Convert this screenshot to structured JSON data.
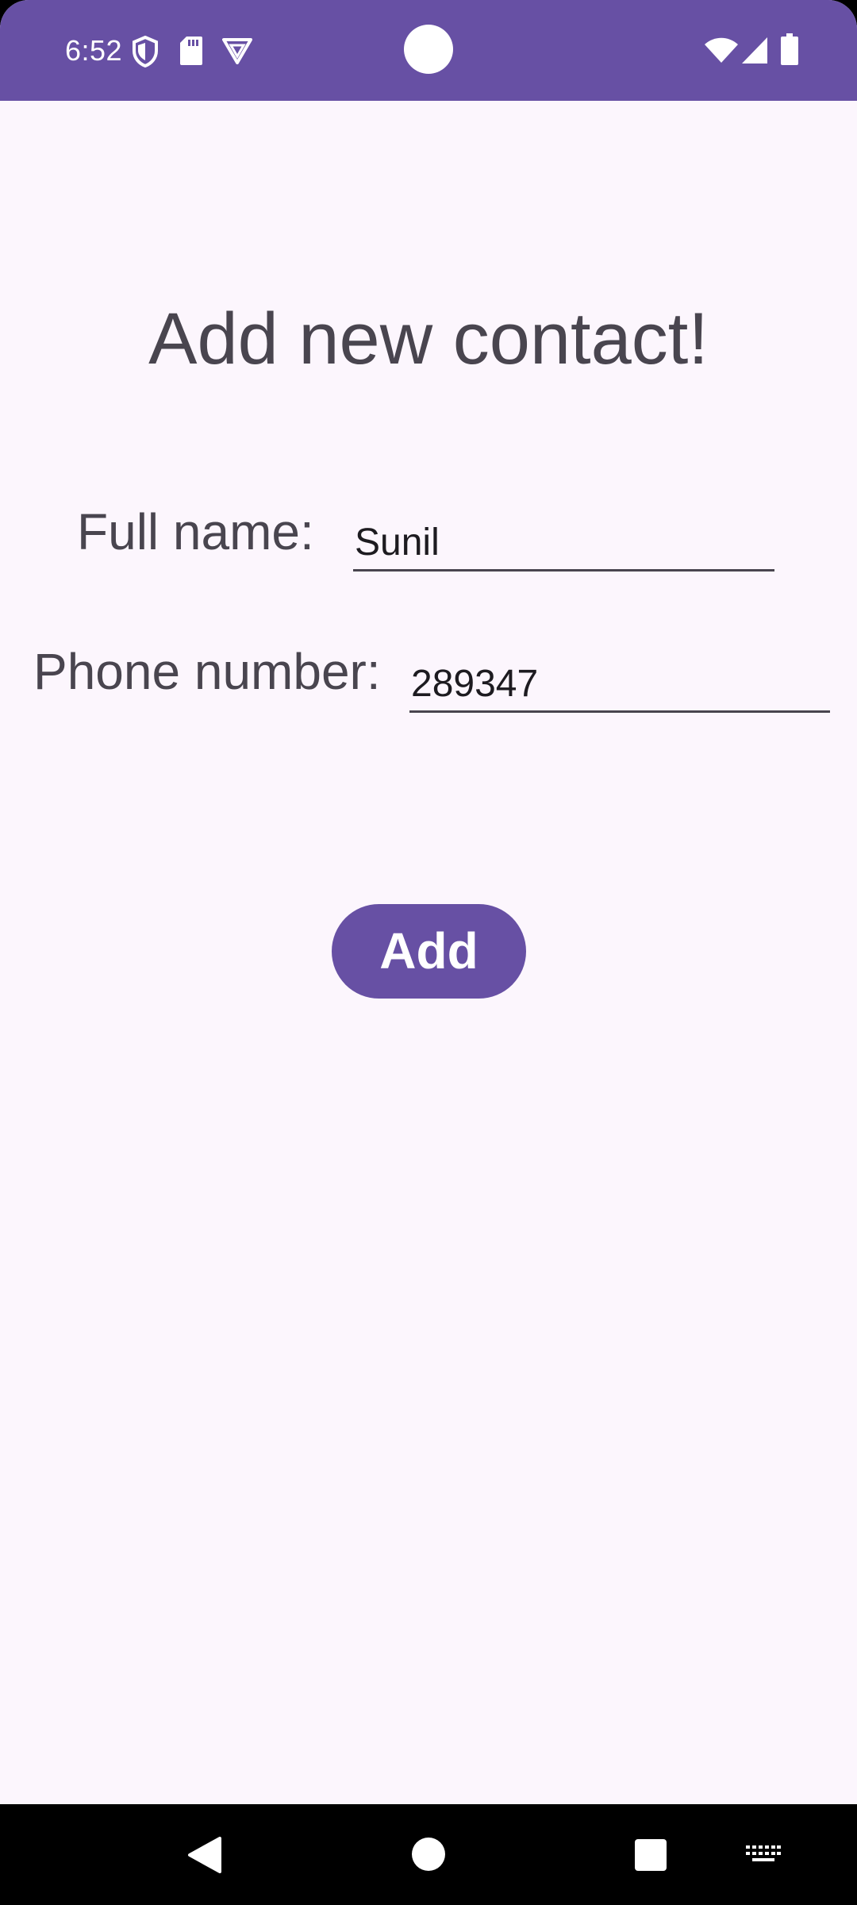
{
  "status_bar": {
    "time": "6:52",
    "color": "#6750a4",
    "left_icons": [
      "shield-icon",
      "sd-card-icon",
      "vpn-icon"
    ],
    "right_icons": [
      "wifi-icon",
      "cell-signal-icon",
      "battery-icon"
    ]
  },
  "form": {
    "title": "Add new contact!",
    "full_name": {
      "label": "Full name:",
      "value": "Sunil"
    },
    "phone_number": {
      "label": "Phone number:",
      "value": "289347"
    },
    "add_button_label": "Add"
  },
  "nav_bar": {
    "buttons": [
      "back-icon",
      "home-icon",
      "recents-icon",
      "keyboard-icon"
    ]
  },
  "colors": {
    "primary": "#6750a4",
    "background": "#fcf6fd",
    "label_text": "#49454f",
    "input_text": "#1d1b20"
  }
}
